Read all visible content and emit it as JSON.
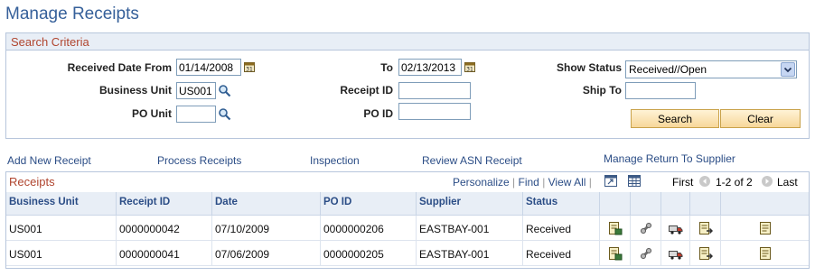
{
  "page": {
    "title": "Manage Receipts"
  },
  "search": {
    "header": "Search Criteria",
    "received_from_label": "Received Date From",
    "received_from_value": "01/14/2008",
    "to_label": "To",
    "to_value": "02/13/2013",
    "show_status_label": "Show Status",
    "show_status_value": "Received//Open",
    "business_unit_label": "Business Unit",
    "business_unit_value": "US001",
    "receipt_id_label": "Receipt ID",
    "receipt_id_value": "",
    "ship_to_label": "Ship To",
    "ship_to_value": "",
    "po_unit_label": "PO Unit",
    "po_unit_value": "",
    "po_id_label": "PO ID",
    "po_id_value": "",
    "search_button": "Search",
    "clear_button": "Clear"
  },
  "links": {
    "add_new_receipt": "Add New Receipt",
    "process_receipts": "Process Receipts",
    "inspection": "Inspection",
    "review_asn_receipt": "Review ASN Receipt",
    "manage_return": "Manage Return To Supplier"
  },
  "grid": {
    "title": "Receipts",
    "personalize": "Personalize",
    "find": "Find",
    "view_all": "View All",
    "first": "First",
    "range": "1-2 of 2",
    "last": "Last",
    "columns": [
      "Business Unit",
      "Receipt ID",
      "Date",
      "PO ID",
      "Supplier",
      "Status"
    ],
    "rows": [
      {
        "business_unit": "US001",
        "receipt_id": "0000000042",
        "date": "07/10/2009",
        "po_id": "0000000206",
        "supplier": "EASTBAY-001",
        "status": "Received"
      },
      {
        "business_unit": "US001",
        "receipt_id": "0000000041",
        "date": "07/06/2009",
        "po_id": "0000000205",
        "supplier": "EASTBAY-001",
        "status": "Received"
      }
    ],
    "row_icons": [
      "receipt-details-icon",
      "inspection-icon",
      "shipment-truck-icon",
      "return-icon",
      "notes-icon"
    ]
  },
  "colors": {
    "title": "#36609a",
    "section_header": "#b0452f",
    "link": "#2b4d86",
    "header_bg": "#e8eef6"
  }
}
